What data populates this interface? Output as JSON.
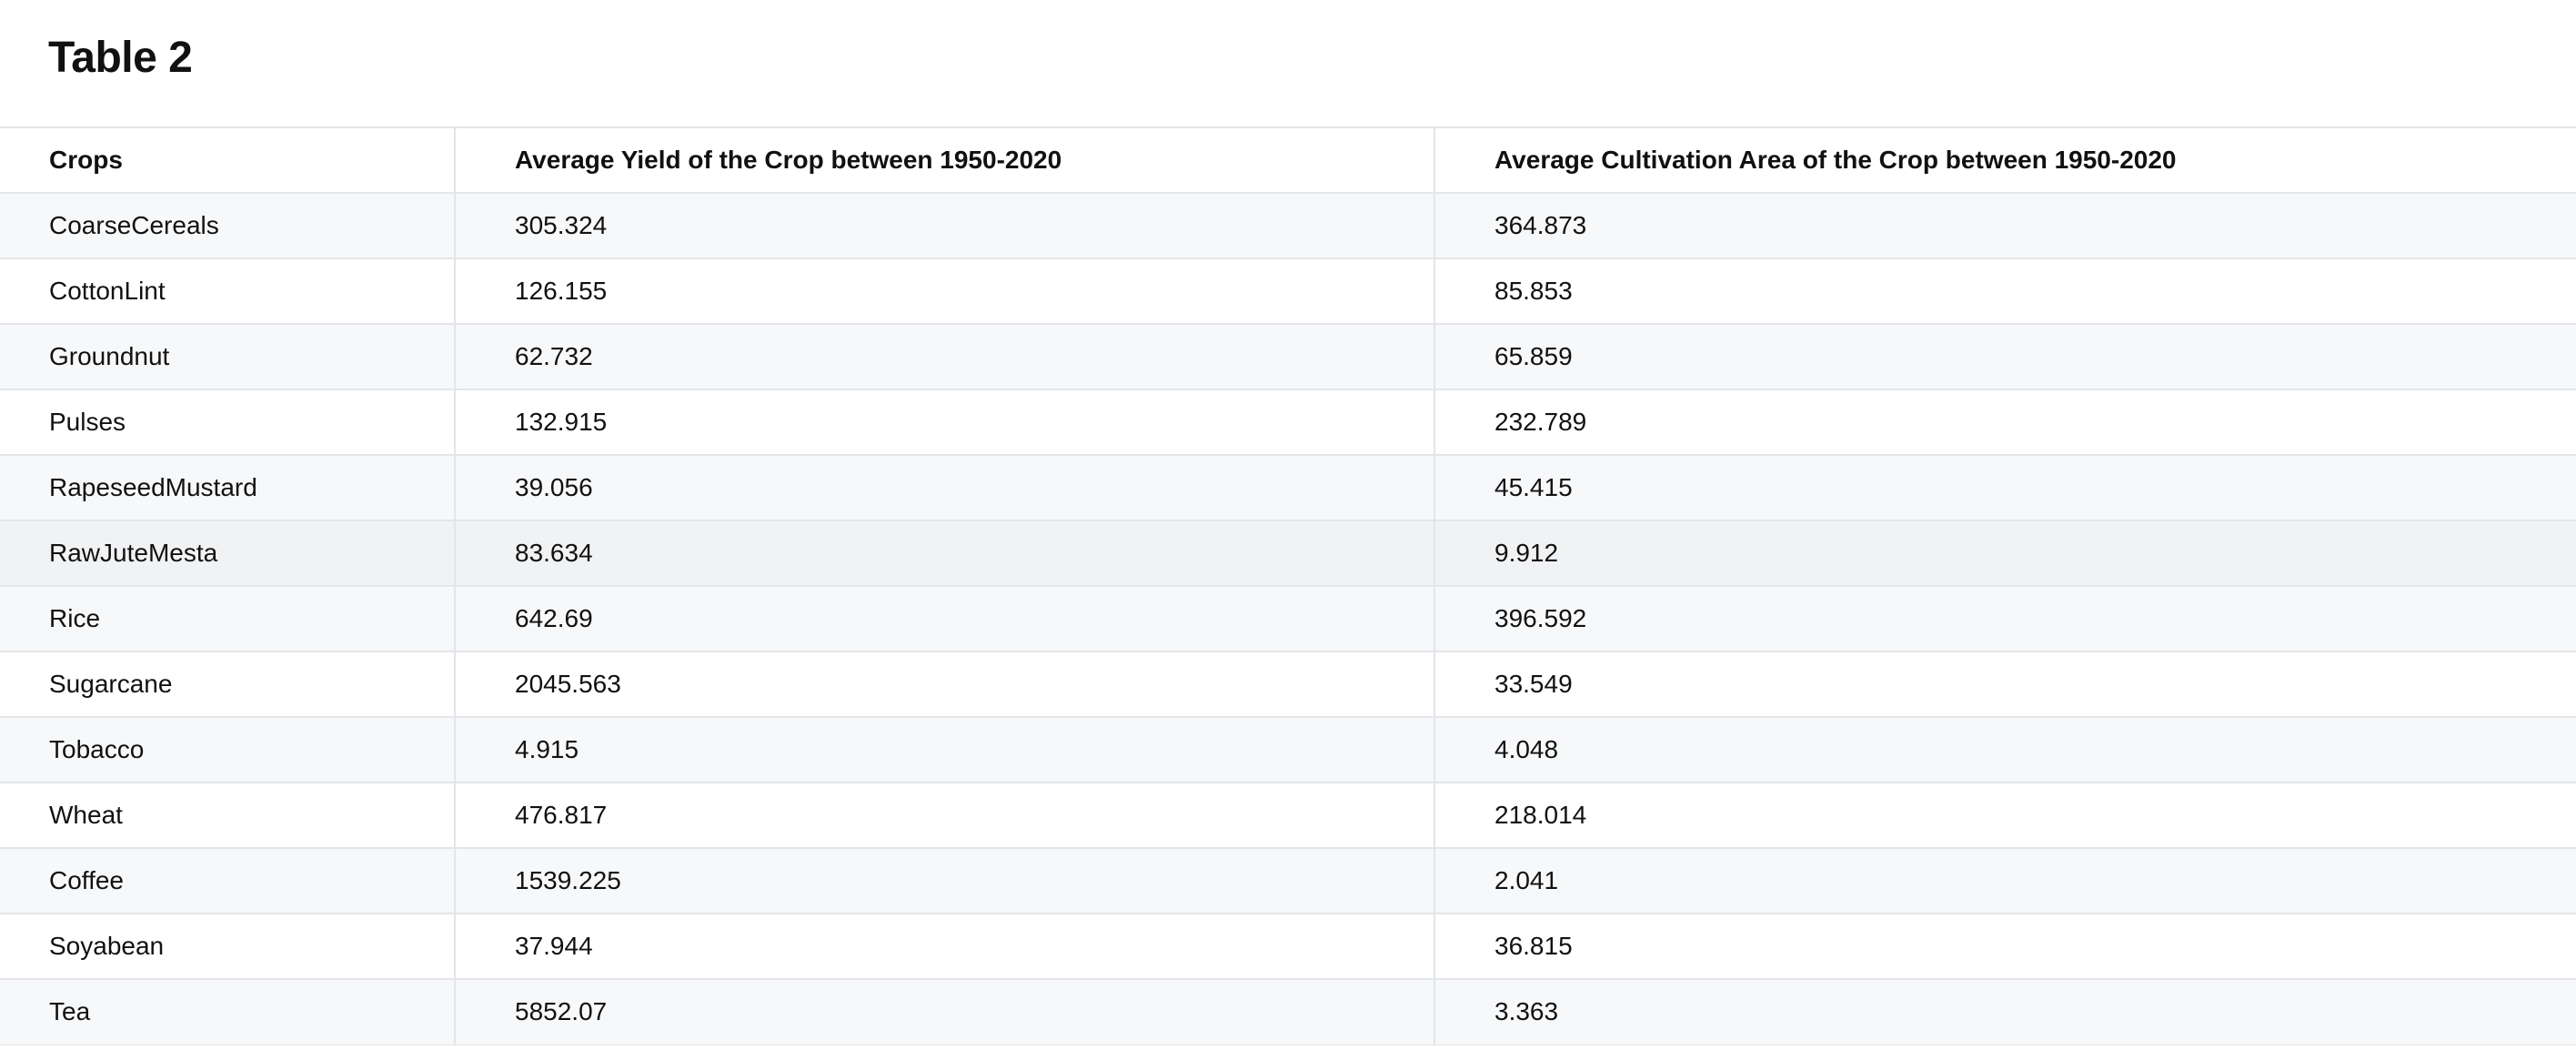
{
  "title": "Table 2",
  "table": {
    "headers": [
      "Crops",
      "Average Yield of the Crop between 1950-2020",
      "Average Cultivation Area of the Crop between 1950-2020"
    ],
    "rows": [
      [
        "CoarseCereals",
        "305.324",
        "364.873"
      ],
      [
        "CottonLint",
        "126.155",
        "85.853"
      ],
      [
        "Groundnut",
        "62.732",
        "65.859"
      ],
      [
        "Pulses",
        "132.915",
        "232.789"
      ],
      [
        "RapeseedMustard",
        "39.056",
        "45.415"
      ],
      [
        "RawJuteMesta",
        "83.634",
        "9.912"
      ],
      [
        "Rice",
        "642.69",
        "396.592"
      ],
      [
        "Sugarcane",
        "2045.563",
        "33.549"
      ],
      [
        "Tobacco",
        "4.915",
        "4.048"
      ],
      [
        "Wheat",
        "476.817",
        "218.014"
      ],
      [
        "Coffee",
        "1539.225",
        "2.041"
      ],
      [
        "Soyabean",
        "37.944",
        "36.815"
      ],
      [
        "Tea",
        "5852.07",
        "3.363"
      ]
    ],
    "highlighted_row_index": 5
  },
  "colors": {
    "border": "#e3e5e8",
    "row_stripe": "#f7f8fa",
    "row_highlight": "#f1f2f4",
    "text": "#111111"
  }
}
